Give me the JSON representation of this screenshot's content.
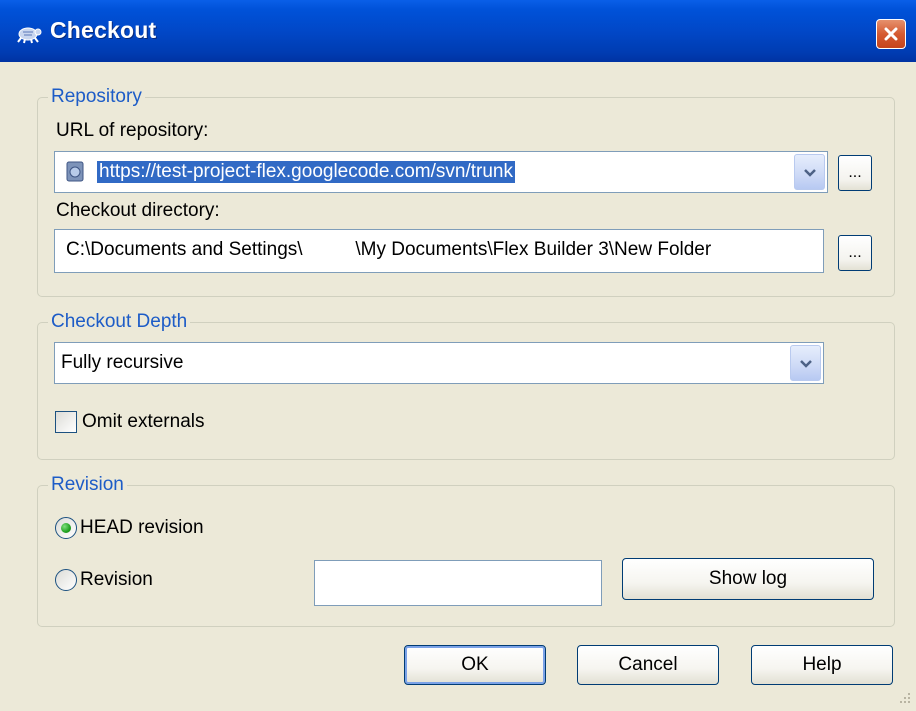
{
  "window": {
    "title": "Checkout",
    "close_icon": "close-icon",
    "app_icon": "tortoise-icon"
  },
  "repository": {
    "legend": "Repository",
    "url_label": "URL of repository:",
    "url_value": "https://test-project-flex.googlecode.com/svn/trunk",
    "url_browse_label": "...",
    "dir_label": "Checkout directory:",
    "dir_value": "C:\\Documents and Settings\\          \\My Documents\\Flex Builder 3\\New Folder",
    "dir_browse_label": "..."
  },
  "depth": {
    "legend": "Checkout Depth",
    "selected": "Fully recursive",
    "omit_externals_label": "Omit externals",
    "omit_externals_checked": false
  },
  "revision": {
    "legend": "Revision",
    "head_label": "HEAD revision",
    "head_selected": true,
    "revision_label": "Revision",
    "revision_value": "",
    "show_log_label": "Show log"
  },
  "buttons": {
    "ok": "OK",
    "cancel": "Cancel",
    "help": "Help"
  },
  "colors": {
    "titlebar": "#0146c5",
    "legend": "#1d5cc7",
    "selection": "#316ac5",
    "dialog_bg": "#ece9d8"
  }
}
